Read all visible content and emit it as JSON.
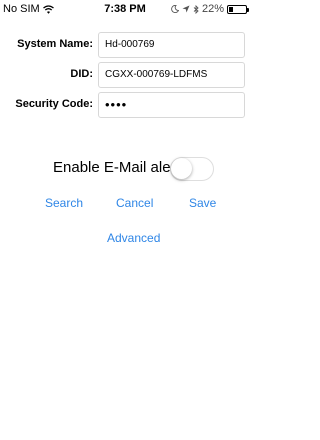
{
  "status_bar": {
    "carrier": "No SIM",
    "wifi_icon": "wifi-icon",
    "time": "7:38 PM",
    "battery_percent": "22%",
    "battery_level": 0.22
  },
  "form": {
    "system_name_label": "System Name:",
    "system_name_value": "Hd-000769",
    "did_label": "DID:",
    "did_value": "CGXX-000769-LDFMS",
    "security_code_label": "Security Code:",
    "security_code_value": "••••",
    "email_alert_label": "Enable E-Mail alert",
    "email_alert_enabled": false
  },
  "actions": {
    "search": "Search",
    "cancel": "Cancel",
    "save": "Save",
    "advanced": "Advanced"
  },
  "colors": {
    "accent": "#2f86e6",
    "field_border": "#d8d8d8",
    "background": "#ffffff"
  }
}
